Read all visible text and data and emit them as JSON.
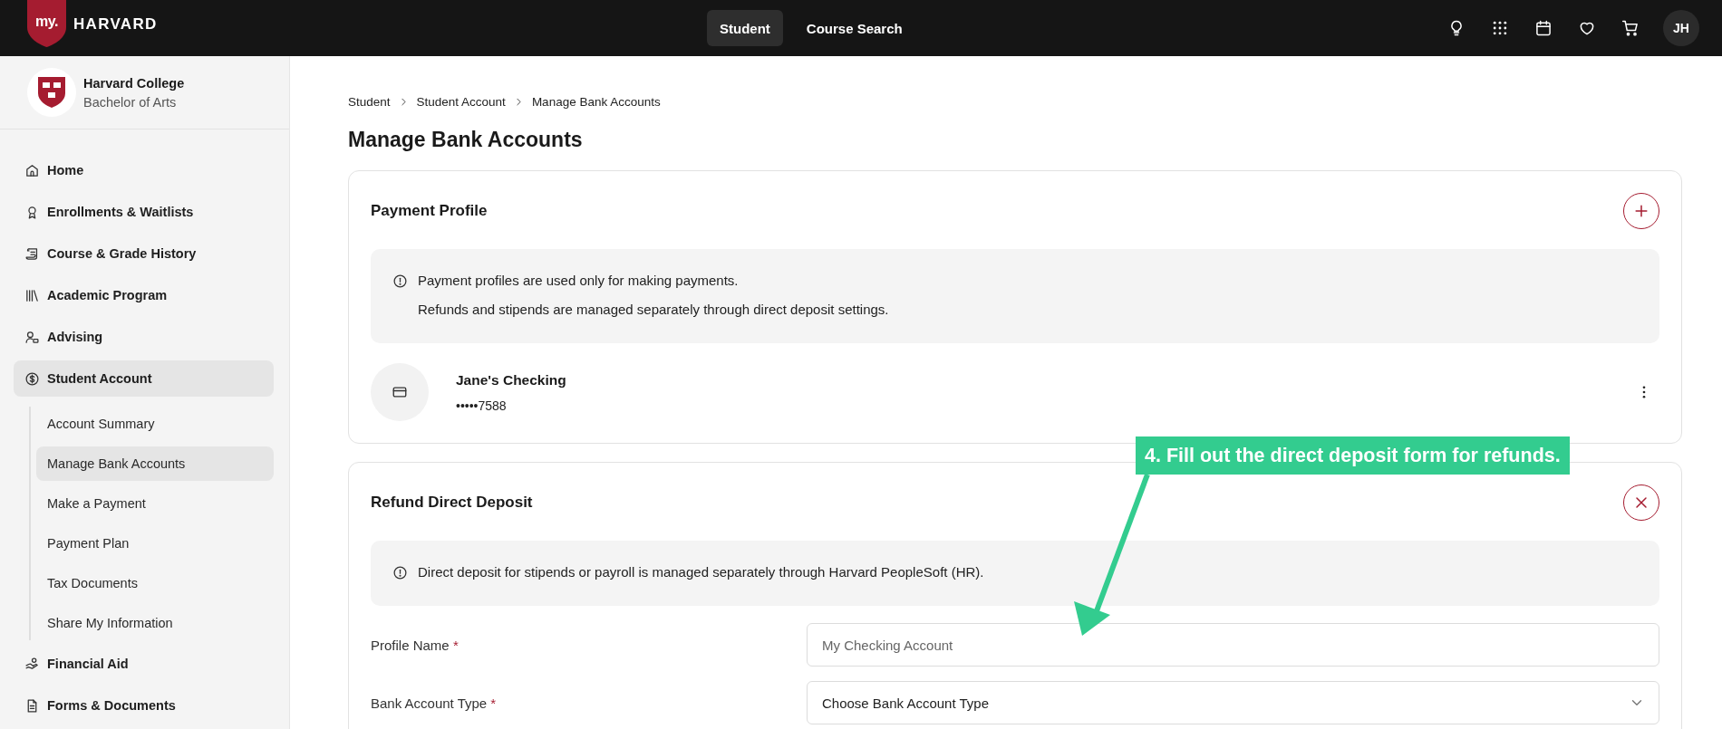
{
  "top_bar": {
    "logo": {
      "badge": "my.",
      "wordmark": "HARVARD"
    },
    "nav": [
      {
        "label": "Student",
        "selected": true
      },
      {
        "label": "Course Search",
        "selected": false
      }
    ],
    "avatar": "JH"
  },
  "sidebar": {
    "school": "Harvard College",
    "degree": "Bachelor of Arts",
    "items": [
      {
        "label": "Home",
        "selected": false
      },
      {
        "label": "Enrollments & Waitlists",
        "selected": false
      },
      {
        "label": "Course & Grade History",
        "selected": false
      },
      {
        "label": "Academic Program",
        "selected": false
      },
      {
        "label": "Advising",
        "selected": false
      },
      {
        "label": "Student Account",
        "selected": true,
        "children": [
          {
            "label": "Account Summary",
            "selected": false
          },
          {
            "label": "Manage Bank Accounts",
            "selected": true
          },
          {
            "label": "Make a Payment",
            "selected": false
          },
          {
            "label": "Payment Plan",
            "selected": false
          },
          {
            "label": "Tax Documents",
            "selected": false
          },
          {
            "label": "Share My Information",
            "selected": false
          }
        ]
      },
      {
        "label": "Financial Aid",
        "selected": false
      },
      {
        "label": "Forms & Documents",
        "selected": false
      }
    ]
  },
  "main": {
    "breadcrumb": [
      "Student",
      "Student Account",
      "Manage Bank Accounts"
    ],
    "title": "Manage Bank Accounts",
    "cards": [
      {
        "title": "Payment Profile",
        "action": {
          "kind": "add"
        },
        "info": [
          "Payment profiles are used only for making payments.",
          "Refunds and stipends are managed separately through direct deposit settings."
        ],
        "accounts": [
          {
            "name": "Jane's Checking",
            "number": "•••••7588"
          }
        ]
      },
      {
        "title": "Refund Direct Deposit",
        "action": {
          "kind": "close"
        },
        "info": [
          "Direct deposit for stipends or payroll is managed separately through Harvard PeopleSoft (HR)."
        ],
        "fields": [
          {
            "label": "Profile Name",
            "required_mark": "*",
            "kind": "text",
            "placeholder": "My Checking Account"
          },
          {
            "label": "Bank Account Type",
            "required_mark": "*",
            "kind": "select",
            "placeholder": "Choose Bank Account Type"
          }
        ]
      }
    ]
  },
  "annotation": {
    "text": "4. Fill out the direct deposit form for refunds."
  }
}
